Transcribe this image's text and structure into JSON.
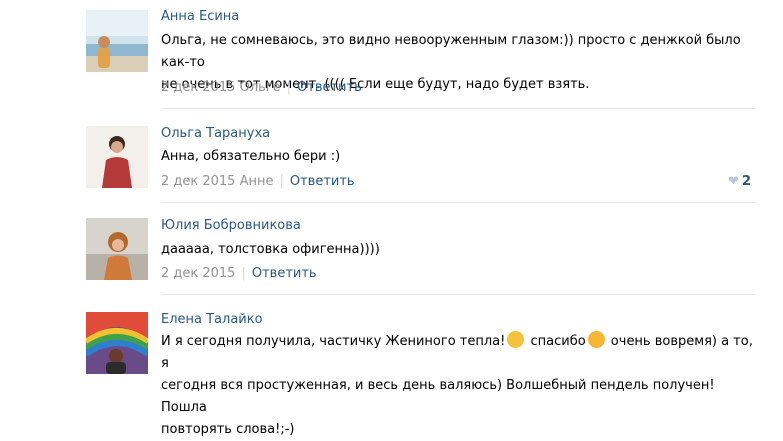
{
  "comments": [
    {
      "author": "Анна Есина",
      "lines": [
        "Ольга, не сомневаюсь, это видно невооруженным глазом:)) просто с денжкой было как-то",
        "не очень в тот момент. (((( Если еще будут, надо будет взять."
      ],
      "date": "2 дек 2015 Ольге",
      "reply_label": "Ответить"
    },
    {
      "author": "Ольга Тарануха",
      "lines": [
        "Анна, обязательно бери :)"
      ],
      "date": "2 дек 2015 Анне",
      "reply_label": "Ответить",
      "likes": "2"
    },
    {
      "author": "Юлия Бобровникова",
      "lines": [
        "дааааа, толстовка офигенна))))"
      ],
      "date": "2 дек 2015",
      "reply_label": "Ответить"
    },
    {
      "author": "Елена Талайко",
      "line1_a": "И я сегодня получила, частичку Жениного тепла!",
      "line1_b": " спасибо",
      "line1_c": " очень вовремя) а то, я",
      "line2": "сегодня вся простуженная, и весь день валяюсь) Волшебный пендель получен! Пошла",
      "line3": "повторять слова!;-)"
    }
  ]
}
